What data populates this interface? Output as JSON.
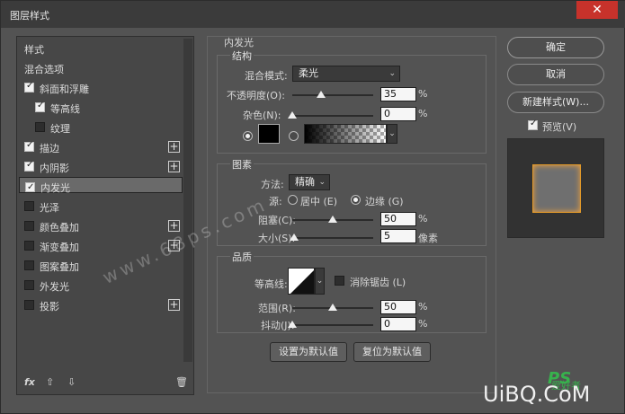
{
  "window": {
    "title": "图层样式",
    "close": "✕"
  },
  "styles_list": {
    "items": [
      {
        "label": "样式",
        "checkbox": false,
        "checked": false,
        "plus": false,
        "selected": false
      },
      {
        "label": "混合选项",
        "checkbox": false,
        "checked": false,
        "plus": false,
        "selected": false
      },
      {
        "label": "斜面和浮雕",
        "checkbox": true,
        "checked": true,
        "plus": false,
        "selected": false
      },
      {
        "label": "等高线",
        "checkbox": true,
        "checked": true,
        "plus": false,
        "selected": false,
        "indent": true
      },
      {
        "label": "纹理",
        "checkbox": true,
        "checked": false,
        "plus": false,
        "selected": false,
        "indent": true
      },
      {
        "label": "描边",
        "checkbox": true,
        "checked": true,
        "plus": true,
        "selected": false
      },
      {
        "label": "内阴影",
        "checkbox": true,
        "checked": true,
        "plus": true,
        "selected": false
      },
      {
        "label": "内发光",
        "checkbox": true,
        "checked": true,
        "plus": false,
        "selected": true
      },
      {
        "label": "光泽",
        "checkbox": true,
        "checked": false,
        "plus": false,
        "selected": false
      },
      {
        "label": "颜色叠加",
        "checkbox": true,
        "checked": false,
        "plus": true,
        "selected": false
      },
      {
        "label": "渐变叠加",
        "checkbox": true,
        "checked": false,
        "plus": true,
        "selected": false
      },
      {
        "label": "图案叠加",
        "checkbox": true,
        "checked": false,
        "plus": false,
        "selected": false
      },
      {
        "label": "外发光",
        "checkbox": true,
        "checked": false,
        "plus": false,
        "selected": false
      },
      {
        "label": "投影",
        "checkbox": true,
        "checked": false,
        "plus": true,
        "selected": false
      }
    ],
    "fx_label": "fx",
    "up_arrow": "⇧",
    "down_arrow": "⇩",
    "trash_icon": "🗑"
  },
  "inner_glow": {
    "section_title": "内发光",
    "structure": {
      "title": "结构",
      "blend_mode_label": "混合模式:",
      "blend_mode_value": "柔光",
      "opacity_label": "不透明度(O):",
      "opacity_value": "35",
      "opacity_unit": "%",
      "opacity_level": 0.35,
      "noise_label": "杂色(N):",
      "noise_value": "0",
      "noise_unit": "%",
      "noise_level": 0,
      "glow_color": "#000000"
    },
    "elements": {
      "title": "图素",
      "technique_label": "方法:",
      "technique_value": "精确",
      "source_label": "源:",
      "source_center": "居中 (E)",
      "source_edge": "边缘 (G)",
      "choke_label": "阻塞(C):",
      "choke_value": "50",
      "choke_unit": "%",
      "choke_level": 0.5,
      "size_label": "大小(S):",
      "size_value": "5",
      "size_unit": "像素",
      "size_level": 0.02
    },
    "quality": {
      "title": "品质",
      "contour_label": "等高线:",
      "antialias_label": "消除锯齿 (L)",
      "range_label": "范围(R):",
      "range_value": "50",
      "range_unit": "%",
      "range_level": 0.5,
      "jitter_label": "抖动(J):",
      "jitter_value": "0",
      "jitter_unit": "%",
      "jitter_level": 0
    },
    "make_default": "设置为默认值",
    "reset_default": "复位为默认值"
  },
  "buttons": {
    "ok": "确定",
    "cancel": "取消",
    "new_style": "新建样式(W)...",
    "preview_label": "预览(V)"
  },
  "overlay": {
    "watermark": "www.68ps.com",
    "brand": "UiBQ.CoM",
    "brand_ps": "PS",
    "brand_sub": "爱好者"
  }
}
